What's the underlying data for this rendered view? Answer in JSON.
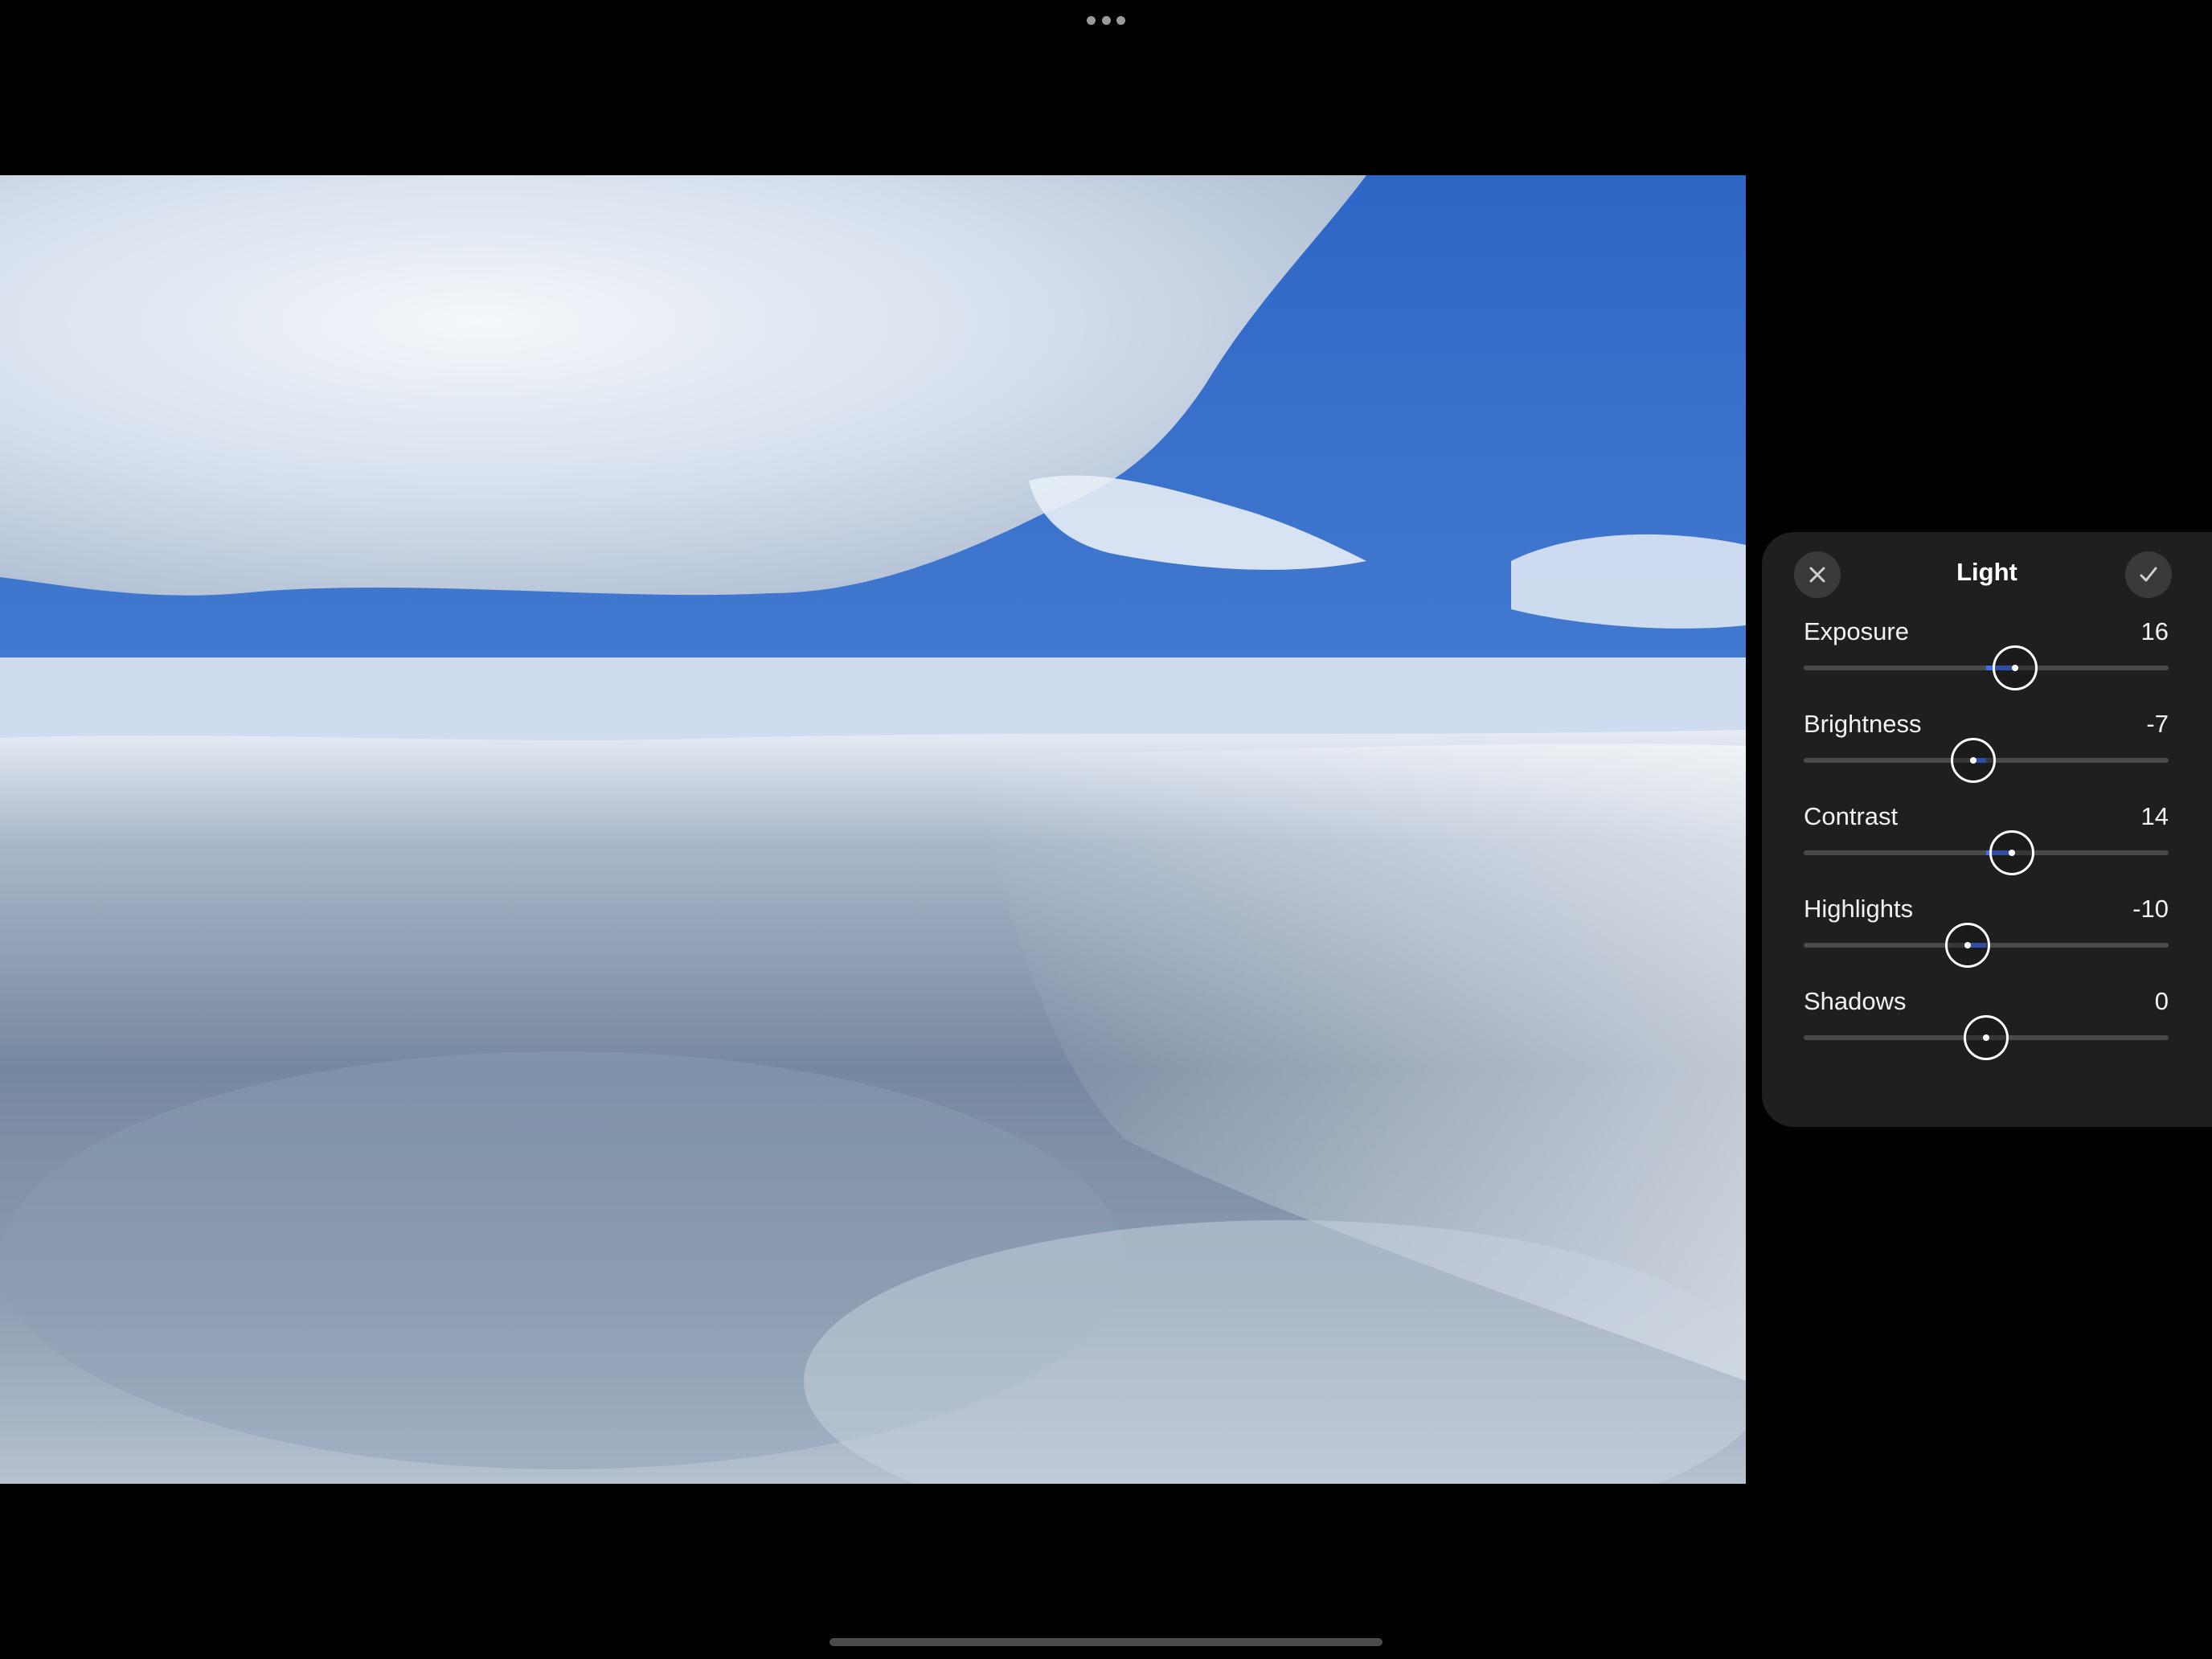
{
  "window": {
    "multitask_icon": "ellipsis-icon"
  },
  "photo": {
    "subject": "sky-above-clouds"
  },
  "panel": {
    "title": "Light",
    "close_icon": "close-icon",
    "done_icon": "checkmark-icon",
    "accent_color": "#3f6ef0",
    "sliders": [
      {
        "label": "Exposure",
        "value": "16",
        "level": 16
      },
      {
        "label": "Brightness",
        "value": "-7",
        "level": -7
      },
      {
        "label": "Contrast",
        "value": "14",
        "level": 14
      },
      {
        "label": "Highlights",
        "value": "-10",
        "level": -10
      },
      {
        "label": "Shadows",
        "value": "0",
        "level": 0
      }
    ]
  }
}
